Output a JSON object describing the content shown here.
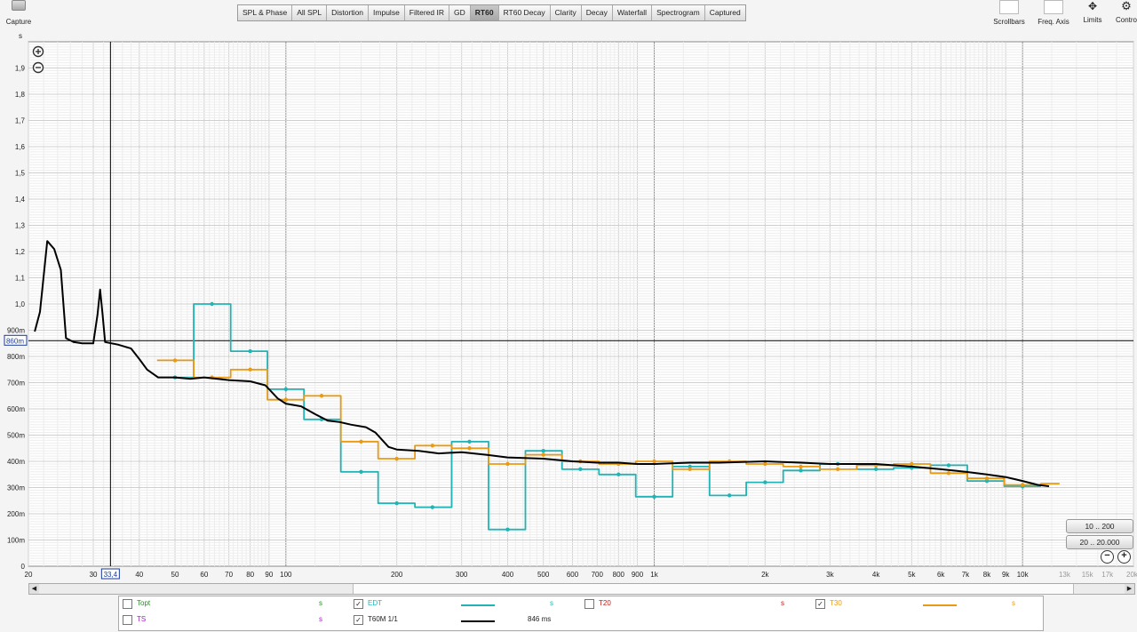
{
  "toolbar": {
    "capture_label": "Capture",
    "units": "s",
    "tabs": [
      "SPL & Phase",
      "All SPL",
      "Distortion",
      "Impulse",
      "Filtered IR",
      "GD",
      "RT60",
      "RT60 Decay",
      "Clarity",
      "Decay",
      "Waterfall",
      "Spectrogram",
      "Captured"
    ],
    "active_tab": "RT60",
    "tools": [
      "Scrollbars",
      "Freq. Axis",
      "Limits",
      "Contro"
    ]
  },
  "plot": {
    "y_ticks": [
      "0",
      "100m",
      "200m",
      "300m",
      "400m",
      "500m",
      "600m",
      "700m",
      "800m",
      "900m",
      "1,0",
      "1,1",
      "1,2",
      "1,3",
      "1,4",
      "1,5",
      "1,6",
      "1,7",
      "1,8",
      "1,9"
    ],
    "x_ticks": [
      "20",
      "30",
      "40",
      "50",
      "60",
      "70",
      "80",
      "90",
      "100",
      "200",
      "300",
      "400",
      "500",
      "600",
      "700",
      "800",
      "900",
      "1k",
      "2k",
      "3k",
      "4k",
      "5k",
      "6k",
      "7k",
      "8k",
      "9k",
      "10k",
      "13k",
      "15k",
      "17k",
      "20kHz"
    ],
    "cursor_x_label": "33,4",
    "cursor_y_label": "860m"
  },
  "range_buttons": [
    "10 .. 200",
    "20 .. 20.000"
  ],
  "colors": {
    "edt": "#21b3b5",
    "t30": "#e89a14",
    "t60m": "#000000",
    "grid": "#cfcfcf",
    "grid_major": "#8c8c8c",
    "topt": "#2a8a2a",
    "t20": "#c01a1a",
    "ts": "#a020c0"
  },
  "legend": [
    [
      {
        "name": "Topt",
        "checked": false,
        "value": "",
        "unit": "s",
        "color": "topt"
      },
      {
        "name": "EDT",
        "checked": true,
        "value": "",
        "unit": "s",
        "color": "edt"
      },
      {
        "name": "T20",
        "checked": false,
        "value": "",
        "unit": "s",
        "color": "t20"
      },
      {
        "name": "T30",
        "checked": true,
        "value": "",
        "unit": "s",
        "color": "t30"
      }
    ],
    [
      {
        "name": "TS",
        "checked": false,
        "value": "",
        "unit": "s",
        "color": "ts"
      },
      {
        "name": "T60M 1/1",
        "checked": true,
        "value": "846 ms",
        "unit": "",
        "color": "t60m"
      }
    ]
  ],
  "chart_data": {
    "type": "line",
    "x_scale": "log",
    "x_range": [
      20,
      20000
    ],
    "y_range": [
      0,
      2.0
    ],
    "y_unit": "s",
    "cursor": {
      "x": 33.4,
      "y": 0.86
    },
    "series": [
      {
        "name": "EDT",
        "color": "edt",
        "step": true,
        "points": [
          [
            44.7,
            0.72
          ],
          [
            56.2,
            0.72
          ],
          [
            56.2,
            1.0
          ],
          [
            70.8,
            1.0
          ],
          [
            70.8,
            0.82
          ],
          [
            89.1,
            0.82
          ],
          [
            89.1,
            0.675
          ],
          [
            112,
            0.675
          ],
          [
            112,
            0.56
          ],
          [
            141,
            0.56
          ],
          [
            141,
            0.36
          ],
          [
            178,
            0.36
          ],
          [
            178,
            0.24
          ],
          [
            224,
            0.24
          ],
          [
            224,
            0.225
          ],
          [
            282,
            0.225
          ],
          [
            282,
            0.475
          ],
          [
            355,
            0.475
          ],
          [
            355,
            0.14
          ],
          [
            447,
            0.14
          ],
          [
            447,
            0.44
          ],
          [
            562,
            0.44
          ],
          [
            562,
            0.37
          ],
          [
            708,
            0.37
          ],
          [
            708,
            0.35
          ],
          [
            891,
            0.35
          ],
          [
            891,
            0.265
          ],
          [
            1122,
            0.265
          ],
          [
            1122,
            0.38
          ],
          [
            1413,
            0.38
          ],
          [
            1413,
            0.27
          ],
          [
            1778,
            0.27
          ],
          [
            1778,
            0.32
          ],
          [
            2239,
            0.32
          ],
          [
            2239,
            0.365
          ],
          [
            2818,
            0.365
          ],
          [
            2818,
            0.39
          ],
          [
            3548,
            0.39
          ],
          [
            3548,
            0.37
          ],
          [
            4467,
            0.37
          ],
          [
            4467,
            0.375
          ],
          [
            5623,
            0.375
          ],
          [
            5623,
            0.385
          ],
          [
            7079,
            0.385
          ],
          [
            7079,
            0.325
          ],
          [
            8913,
            0.325
          ],
          [
            8913,
            0.305
          ],
          [
            11220,
            0.305
          ]
        ],
        "markers": [
          [
            50,
            0.72
          ],
          [
            63,
            1.0
          ],
          [
            80,
            0.82
          ],
          [
            100,
            0.675
          ],
          [
            125,
            0.56
          ],
          [
            160,
            0.36
          ],
          [
            200,
            0.24
          ],
          [
            250,
            0.225
          ],
          [
            315,
            0.475
          ],
          [
            400,
            0.14
          ],
          [
            500,
            0.44
          ],
          [
            630,
            0.37
          ],
          [
            800,
            0.35
          ],
          [
            1000,
            0.265
          ],
          [
            1250,
            0.38
          ],
          [
            1600,
            0.27
          ],
          [
            2000,
            0.32
          ],
          [
            2500,
            0.365
          ],
          [
            3150,
            0.39
          ],
          [
            4000,
            0.37
          ],
          [
            5000,
            0.375
          ],
          [
            6300,
            0.385
          ],
          [
            8000,
            0.325
          ],
          [
            10000,
            0.305
          ]
        ]
      },
      {
        "name": "T30",
        "color": "t30",
        "step": true,
        "points": [
          [
            44.7,
            0.785
          ],
          [
            56.2,
            0.785
          ],
          [
            56.2,
            0.72
          ],
          [
            70.8,
            0.72
          ],
          [
            70.8,
            0.75
          ],
          [
            89.1,
            0.75
          ],
          [
            89.1,
            0.635
          ],
          [
            112,
            0.635
          ],
          [
            112,
            0.65
          ],
          [
            141,
            0.65
          ],
          [
            141,
            0.475
          ],
          [
            178,
            0.475
          ],
          [
            178,
            0.41
          ],
          [
            224,
            0.41
          ],
          [
            224,
            0.46
          ],
          [
            282,
            0.46
          ],
          [
            282,
            0.45
          ],
          [
            355,
            0.45
          ],
          [
            355,
            0.39
          ],
          [
            447,
            0.39
          ],
          [
            447,
            0.425
          ],
          [
            562,
            0.425
          ],
          [
            562,
            0.4
          ],
          [
            708,
            0.4
          ],
          [
            708,
            0.39
          ],
          [
            891,
            0.39
          ],
          [
            891,
            0.4
          ],
          [
            1122,
            0.4
          ],
          [
            1122,
            0.37
          ],
          [
            1413,
            0.37
          ],
          [
            1413,
            0.4
          ],
          [
            1778,
            0.4
          ],
          [
            1778,
            0.39
          ],
          [
            2239,
            0.39
          ],
          [
            2239,
            0.38
          ],
          [
            2818,
            0.38
          ],
          [
            2818,
            0.37
          ],
          [
            3548,
            0.37
          ],
          [
            3548,
            0.385
          ],
          [
            4467,
            0.385
          ],
          [
            4467,
            0.39
          ],
          [
            5623,
            0.39
          ],
          [
            5623,
            0.355
          ],
          [
            7079,
            0.355
          ],
          [
            7079,
            0.335
          ],
          [
            8913,
            0.335
          ],
          [
            8913,
            0.31
          ],
          [
            11220,
            0.31
          ],
          [
            11220,
            0.315
          ],
          [
            12600,
            0.315
          ]
        ],
        "markers": [
          [
            50,
            0.785
          ],
          [
            63,
            0.72
          ],
          [
            80,
            0.75
          ],
          [
            100,
            0.635
          ],
          [
            125,
            0.65
          ],
          [
            160,
            0.475
          ],
          [
            200,
            0.41
          ],
          [
            250,
            0.46
          ],
          [
            315,
            0.45
          ],
          [
            400,
            0.39
          ],
          [
            500,
            0.425
          ],
          [
            630,
            0.4
          ],
          [
            800,
            0.39
          ],
          [
            1000,
            0.4
          ],
          [
            1250,
            0.37
          ],
          [
            1600,
            0.4
          ],
          [
            2000,
            0.39
          ],
          [
            2500,
            0.38
          ],
          [
            3150,
            0.37
          ],
          [
            4000,
            0.385
          ],
          [
            5000,
            0.39
          ],
          [
            6300,
            0.355
          ],
          [
            8000,
            0.335
          ],
          [
            10000,
            0.31
          ]
        ]
      },
      {
        "name": "T60M 1/1",
        "color": "t60m",
        "step": false,
        "points": [
          [
            20.8,
            0.895
          ],
          [
            21.5,
            0.97
          ],
          [
            22.5,
            1.24
          ],
          [
            23.5,
            1.21
          ],
          [
            24.5,
            1.13
          ],
          [
            25.3,
            0.87
          ],
          [
            26.5,
            0.855
          ],
          [
            28,
            0.85
          ],
          [
            30,
            0.85
          ],
          [
            30.8,
            0.96
          ],
          [
            31.3,
            1.055
          ],
          [
            31.8,
            0.96
          ],
          [
            32.3,
            0.855
          ],
          [
            35,
            0.845
          ],
          [
            38,
            0.83
          ],
          [
            40,
            0.79
          ],
          [
            42,
            0.75
          ],
          [
            45,
            0.72
          ],
          [
            50,
            0.72
          ],
          [
            55,
            0.715
          ],
          [
            60,
            0.72
          ],
          [
            65,
            0.715
          ],
          [
            70,
            0.71
          ],
          [
            80,
            0.705
          ],
          [
            88,
            0.69
          ],
          [
            95,
            0.64
          ],
          [
            100,
            0.62
          ],
          [
            110,
            0.61
          ],
          [
            120,
            0.58
          ],
          [
            130,
            0.555
          ],
          [
            140,
            0.55
          ],
          [
            150,
            0.54
          ],
          [
            165,
            0.53
          ],
          [
            175,
            0.51
          ],
          [
            190,
            0.455
          ],
          [
            200,
            0.445
          ],
          [
            230,
            0.44
          ],
          [
            260,
            0.43
          ],
          [
            300,
            0.435
          ],
          [
            350,
            0.425
          ],
          [
            400,
            0.415
          ],
          [
            500,
            0.41
          ],
          [
            600,
            0.4
          ],
          [
            700,
            0.395
          ],
          [
            800,
            0.395
          ],
          [
            900,
            0.39
          ],
          [
            1000,
            0.39
          ],
          [
            1250,
            0.395
          ],
          [
            1500,
            0.395
          ],
          [
            2000,
            0.4
          ],
          [
            2500,
            0.395
          ],
          [
            3000,
            0.39
          ],
          [
            4000,
            0.39
          ],
          [
            5000,
            0.38
          ],
          [
            6000,
            0.37
          ],
          [
            7000,
            0.36
          ],
          [
            8000,
            0.35
          ],
          [
            9000,
            0.34
          ],
          [
            10000,
            0.325
          ],
          [
            11000,
            0.31
          ],
          [
            11800,
            0.305
          ]
        ]
      }
    ]
  }
}
